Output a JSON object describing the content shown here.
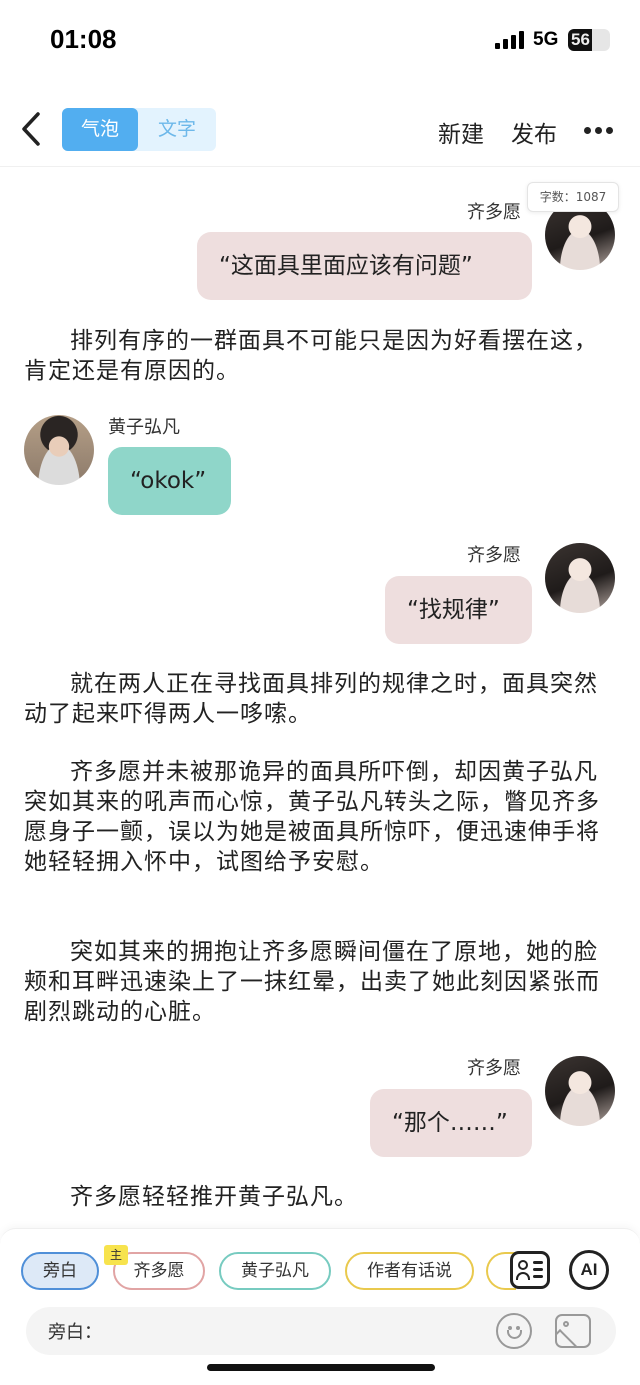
{
  "status": {
    "time": "01:08",
    "network": "5G",
    "battery": "56",
    "battery_level": 56
  },
  "nav": {
    "tab_bubble": "气泡",
    "tab_text": "文字",
    "new_label": "新建",
    "publish_label": "发布"
  },
  "word_count": "字数：1087",
  "messages": [
    {
      "speaker": "齐多愿",
      "text": "“这面具里面应该有问题”"
    },
    {
      "narration": "排列有序的一群面具不可能只是因为好看摆在这，肯定还是有原因的。"
    },
    {
      "speaker": "黄子弘凡",
      "text": "“okok”"
    },
    {
      "speaker": "齐多愿",
      "text": "“找规律”"
    },
    {
      "narration": "就在两人正在寻找面具排列的规律之时，面具突然动了起来吓得两人一哆嗦。"
    },
    {
      "narration": "齐多愿并未被那诡异的面具所吓倒，却因黄子弘凡突如其来的吼声而心惊，黄子弘凡转头之际，瞥见齐多愿身子一颤，误以为她是被面具所惊吓，便迅速伸手将她轻轻拥入怀中，试图给予安慰。"
    },
    {
      "narration": "突如其来的拥抱让齐多愿瞬间僵在了原地，她的脸颊和耳畔迅速染上了一抹红晕，出卖了她此刻因紧张而剧烈跳动的心脏。"
    },
    {
      "speaker": "齐多愿",
      "text": "“那个……”"
    },
    {
      "narration": "齐多愿轻轻推开黄子弘凡。"
    }
  ],
  "bottom": {
    "chips": [
      "旁白",
      "齐多愿",
      "黄子弘凡",
      "作者有话说"
    ],
    "main_tag": "主",
    "ai_label": "AI",
    "input_label": "旁白："
  },
  "colors": {
    "accent": "#52aef0",
    "pink_bubble": "#eedede",
    "teal_bubble": "#8fd6c9"
  }
}
